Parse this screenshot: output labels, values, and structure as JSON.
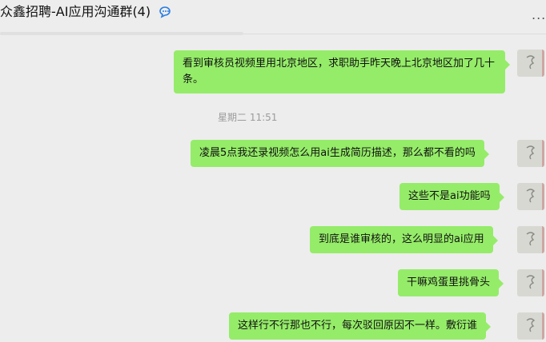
{
  "header": {
    "title": "众鑫招聘-AI应用沟通群(4)",
    "more_label": "..."
  },
  "messages": [
    {
      "text": "看到审核员视频里用北京地区，求职助手昨天晚上北京地区加了几十条。"
    },
    {
      "text": "凌晨5点我还录视频怎么用ai生成简历描述，那么都不看的吗"
    },
    {
      "text": "这些不是ai功能吗"
    },
    {
      "text": "到底是谁审核的，这么明显的ai应用"
    },
    {
      "text": "干嘛鸡蛋里挑骨头"
    },
    {
      "text": "这样行不行那也不行，每次驳回原因不一样。敷衍谁"
    }
  ],
  "timestamp": "星期二 11:51",
  "colors": {
    "bubble": "#95ec69",
    "background": "#ededed",
    "timestamp": "#9b9b9b"
  }
}
